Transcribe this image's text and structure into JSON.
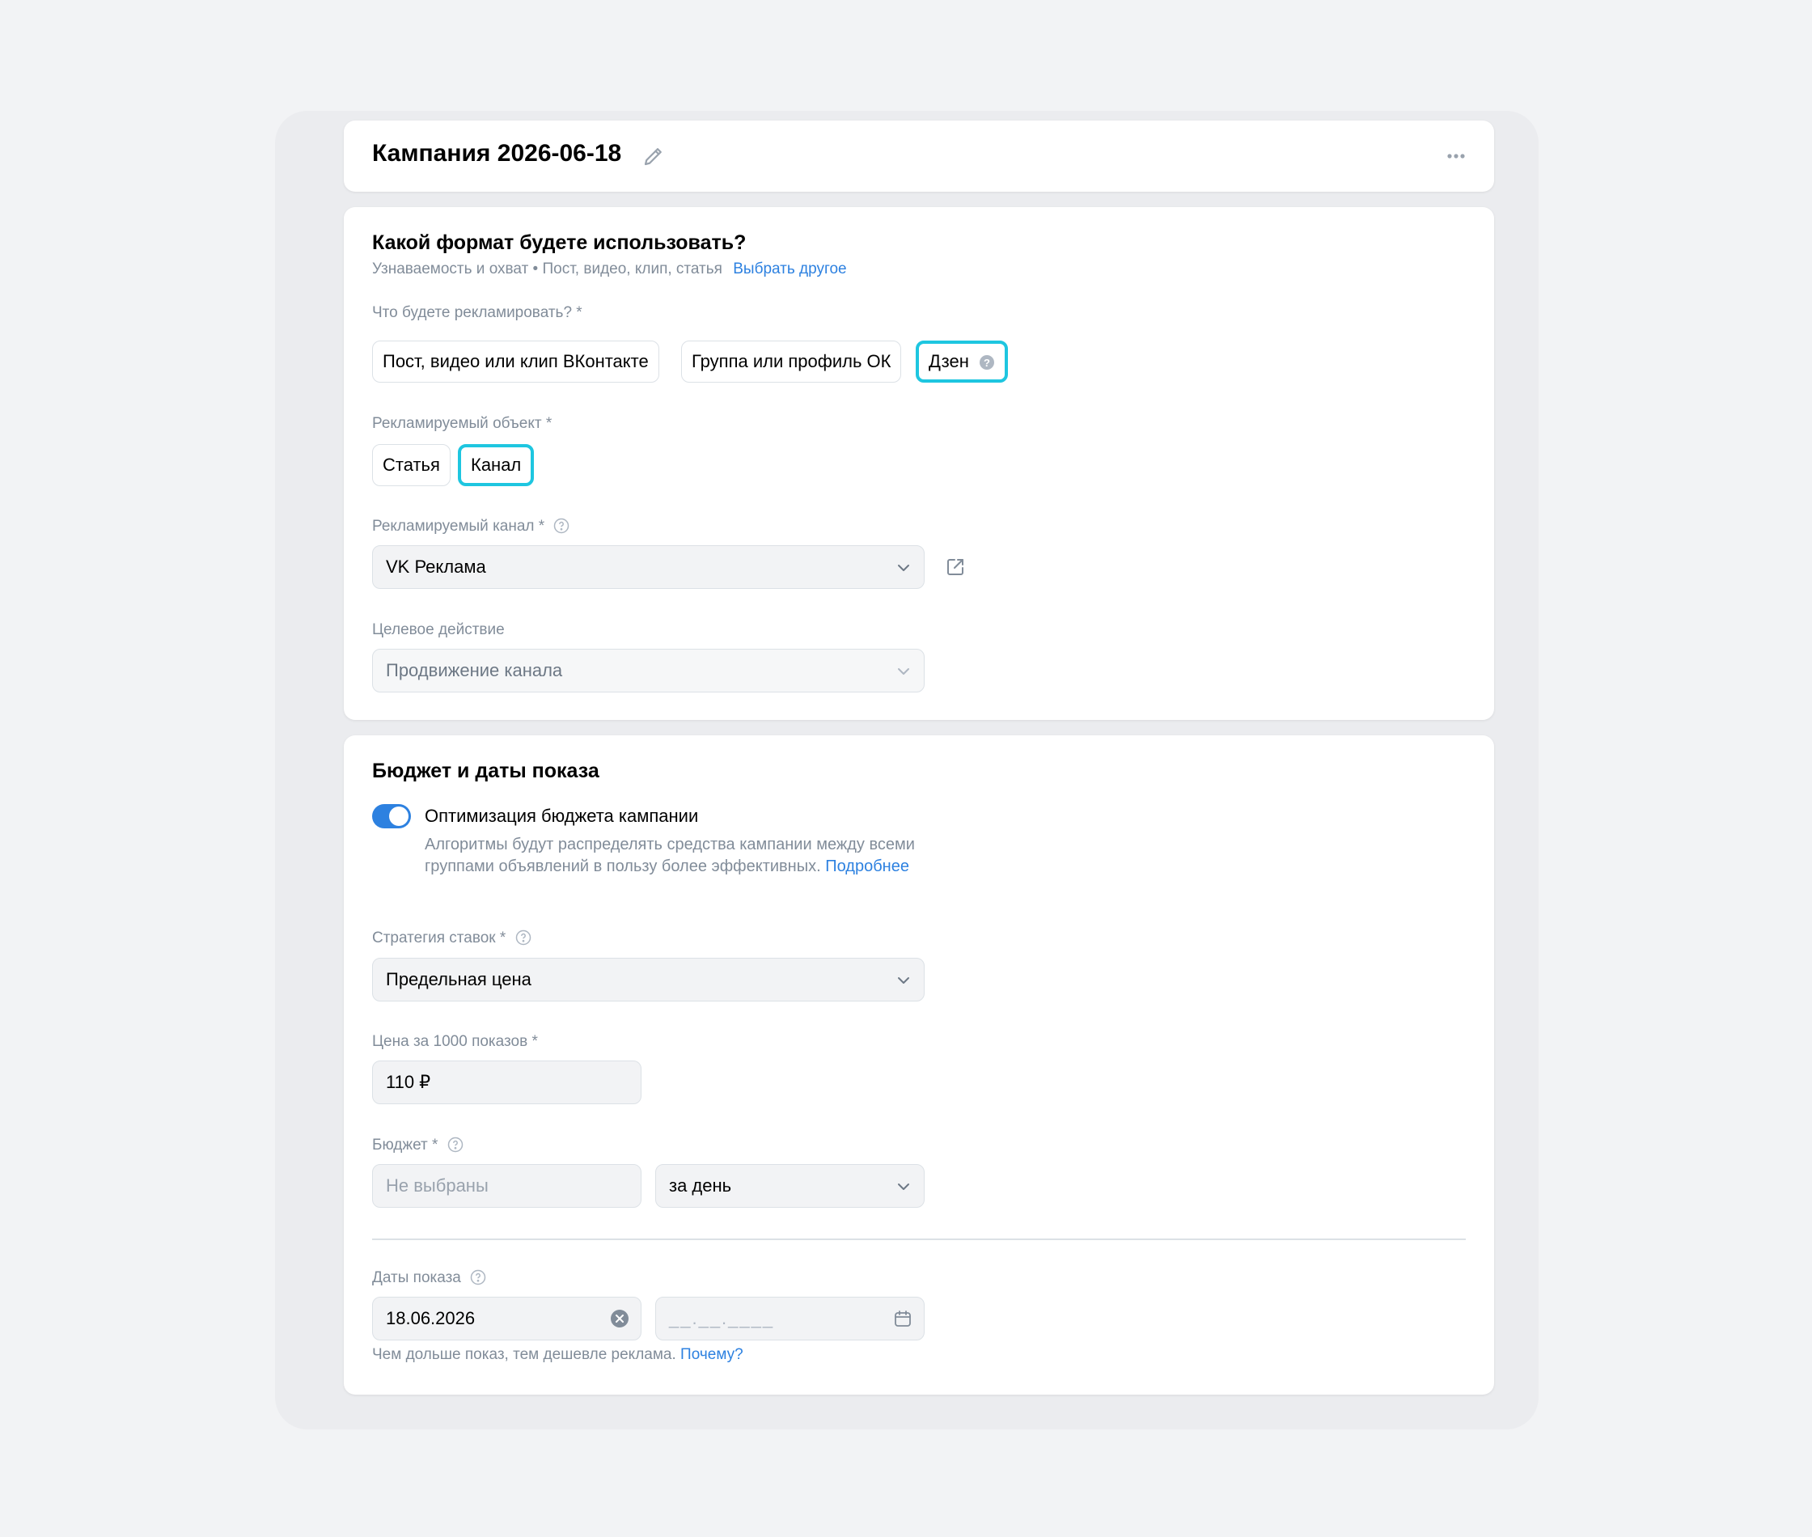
{
  "header": {
    "title": "Кампания 2026-06-18"
  },
  "format": {
    "heading": "Какой формат будете использовать?",
    "subtitle": "Узнаваемость и охват • Пост, видео, клип, статья",
    "change_link": "Выбрать другое",
    "promote_label": "Что будете рекламировать? *",
    "promote_options": [
      "Пост, видео или клип ВКонтакте",
      "Группа или профиль ОК",
      "Дзен"
    ],
    "promote_selected": "Дзен",
    "object_label": "Рекламируемый объект *",
    "object_options": [
      "Статья",
      "Канал"
    ],
    "object_selected": "Канал",
    "channel_label": "Рекламируемый канал *",
    "channel_value": "VK Реклама",
    "action_label": "Целевое действие",
    "action_value": "Продвижение канала"
  },
  "budget": {
    "heading": "Бюджет и даты показа",
    "optimization_label": "Оптимизация бюджета кампании",
    "optimization_enabled": true,
    "optimization_desc": "Алгоритмы будут распределять средства кампании между всеми группами объявлений в пользу более эффективных.",
    "optimization_link": "Подробнее",
    "strategy_label": "Стратегия ставок *",
    "strategy_value": "Предельная цена",
    "price_label": "Цена за 1000 показов *",
    "price_value": "110 ₽",
    "budget_label": "Бюджет *",
    "budget_placeholder": "Не выбраны",
    "budget_period": "за день",
    "dates_label": "Даты показа",
    "date_start": "18.06.2026",
    "date_end_placeholder": "__.__.____",
    "dates_hint": "Чем дольше показ, тем дешевле реклама.",
    "dates_hint_link": "Почему?"
  },
  "colors": {
    "accent": "#2d81e0",
    "selected_outline": "#1ec6e0",
    "secondary_text": "#818c99"
  }
}
